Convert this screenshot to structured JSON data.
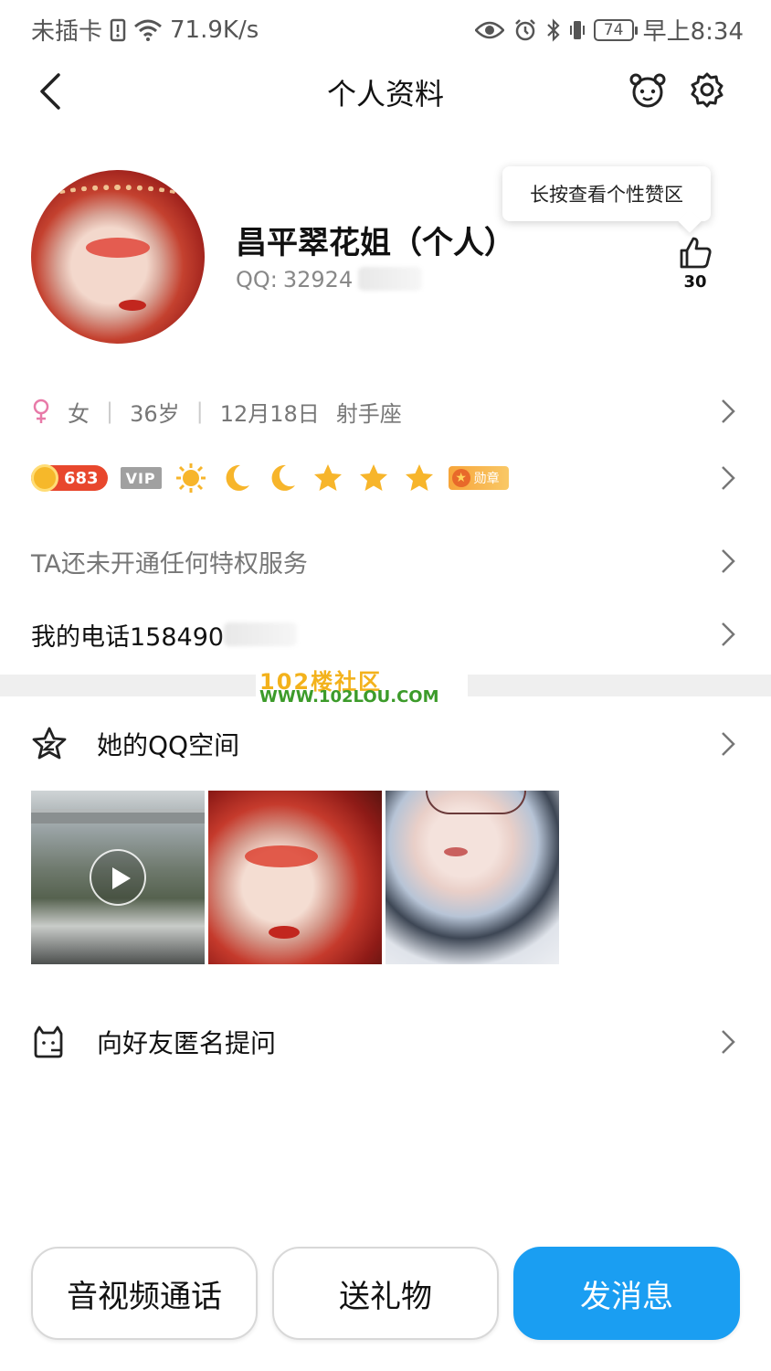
{
  "status_bar": {
    "carrier": "未插卡",
    "speed": "71.9K/s",
    "battery": "74",
    "time": "早上8:34"
  },
  "nav": {
    "title": "个人资料"
  },
  "profile": {
    "nickname": "昌平翠花姐（个人）",
    "qq_label": "QQ:",
    "qq_number_visible": "32924",
    "tooltip": "长按查看个性赞区",
    "like_count": "30"
  },
  "info": {
    "gender": "女",
    "age": "36岁",
    "birthday": "12月18日",
    "zodiac": "射手座"
  },
  "badges": {
    "level": "683",
    "vip": "VIP",
    "medal": "勋章"
  },
  "privilege_text": "TA还未开通任何特权服务",
  "phone_text": "我的电话158490",
  "watermark": {
    "title": "102楼社区",
    "url": "WWW.102LOU.COM"
  },
  "zone": {
    "label": "她的QQ空间"
  },
  "ask": {
    "label": "向好友匿名提问"
  },
  "actions": {
    "call": "音视频通话",
    "gift": "送礼物",
    "message": "发消息"
  },
  "colors": {
    "primary_blue": "#1a9ef2",
    "level_red": "#e8472d",
    "medal_orange": "#f7a53a"
  }
}
